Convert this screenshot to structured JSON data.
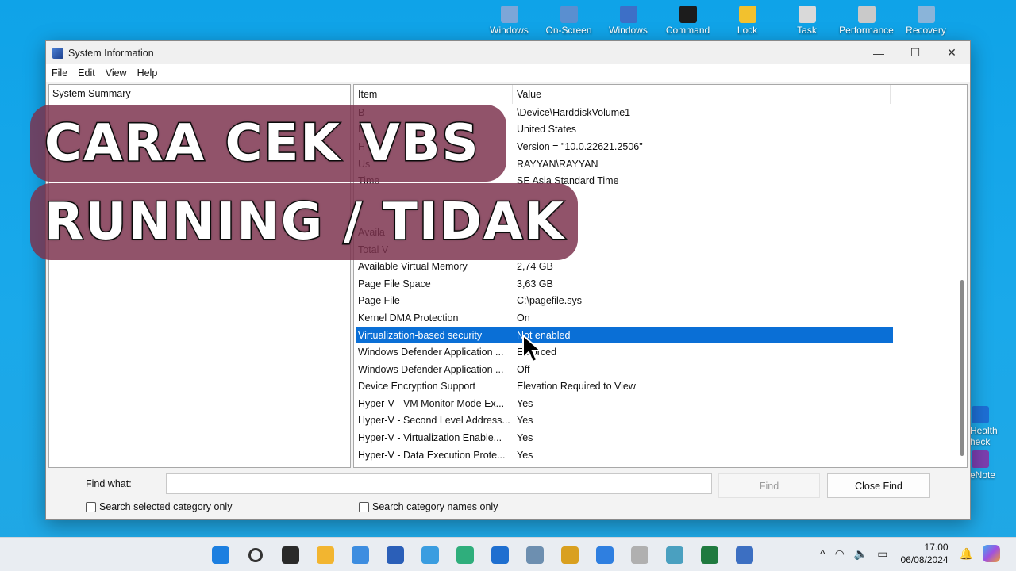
{
  "desktop": {
    "top_icons": [
      {
        "label": "Windows",
        "icon": "windows-tools-icon",
        "color": "#7da6d8"
      },
      {
        "label": "On-Screen",
        "icon": "keyboard-icon",
        "color": "#5a8fd0"
      },
      {
        "label": "Windows",
        "icon": "powershell-icon",
        "color": "#3d6fc7"
      },
      {
        "label": "Command",
        "icon": "terminal-icon",
        "color": "#1c1c1c"
      },
      {
        "label": "Lock",
        "icon": "lock-icon",
        "color": "#f2c12e"
      },
      {
        "label": "Task",
        "icon": "task-scheduler-icon",
        "color": "#d9d9d9"
      },
      {
        "label": "Performance",
        "icon": "performance-icon",
        "color": "#c9c9c9"
      },
      {
        "label": "Recovery",
        "icon": "recovery-icon",
        "color": "#8ab4d9"
      }
    ],
    "right_icons": [
      {
        "label": "Health\nheck",
        "icon": "health-check-icon",
        "color": "#1d6fd6"
      },
      {
        "label": "eNote",
        "icon": "onenote-icon",
        "color": "#7b3fb0"
      }
    ]
  },
  "window": {
    "title": "System Information",
    "controls": {
      "minimize": "—",
      "maximize": "☐",
      "close": "✕"
    },
    "menu": [
      "File",
      "Edit",
      "View",
      "Help"
    ],
    "tree": {
      "root": "System Summary"
    },
    "list": {
      "headers": {
        "item": "Item",
        "value": "Value"
      },
      "rows": [
        {
          "item": "B",
          "value": "\\Device\\HarddiskVolume1"
        },
        {
          "item": "L",
          "value": "United States"
        },
        {
          "item": "H",
          "value": "Version = \"10.0.22621.2506\""
        },
        {
          "item": "Us",
          "value": "RAYYAN\\RAYYAN"
        },
        {
          "item": "Time",
          "value": "SE Asia Standard Time"
        },
        {
          "item": "",
          "value": ""
        },
        {
          "item": "",
          "value": ""
        },
        {
          "item": "Availa",
          "value": ""
        },
        {
          "item": "Total V",
          "value": ""
        },
        {
          "item": "Available Virtual Memory",
          "value": "2,74 GB"
        },
        {
          "item": "Page File Space",
          "value": "3,63 GB"
        },
        {
          "item": "Page File",
          "value": "C:\\pagefile.sys"
        },
        {
          "item": "Kernel DMA Protection",
          "value": "On"
        },
        {
          "item": "Virtualization-based security",
          "value": "Not enabled",
          "selected": true
        },
        {
          "item": "Windows Defender Application ...",
          "value": "Enforced"
        },
        {
          "item": "Windows Defender Application ...",
          "value": "Off"
        },
        {
          "item": "Device Encryption Support",
          "value": "Elevation Required to View"
        },
        {
          "item": "Hyper-V - VM Monitor Mode Ex...",
          "value": "Yes"
        },
        {
          "item": "Hyper-V - Second Level Address...",
          "value": "Yes"
        },
        {
          "item": "Hyper-V - Virtualization Enable...",
          "value": "Yes"
        },
        {
          "item": "Hyper-V - Data Execution Prote...",
          "value": "Yes"
        }
      ]
    },
    "find": {
      "label": "Find what:",
      "value": "",
      "find_button": "Find",
      "close_find_button": "Close Find",
      "check_selected": "Search selected category only",
      "check_names": "Search category names only"
    },
    "selection_color": "#0a6fd6"
  },
  "overlay": {
    "line1": "CARA CEK VBS",
    "line2": "RUNNING / TIDAK",
    "banner_color": "#7c324e"
  },
  "taskbar": {
    "apps": [
      {
        "icon": "windows-start-icon",
        "color": "#1c7fe0"
      },
      {
        "icon": "search-icon",
        "color": "#333333"
      },
      {
        "icon": "obs-icon",
        "color": "#2a2a2a"
      },
      {
        "icon": "file-explorer-icon",
        "color": "#f2b530"
      },
      {
        "icon": "store-icon",
        "color": "#3d8de0"
      },
      {
        "icon": "word-icon",
        "color": "#2b5fb8"
      },
      {
        "icon": "photos-icon",
        "color": "#3a9de0"
      },
      {
        "icon": "edge-icon",
        "color": "#2fae7c"
      },
      {
        "icon": "pulse-icon",
        "color": "#1f6fd0"
      },
      {
        "icon": "image-viewer-icon",
        "color": "#6d8fb0"
      },
      {
        "icon": "clock-app-icon",
        "color": "#d9a020"
      },
      {
        "icon": "calendar-icon",
        "color": "#2f7fe0"
      },
      {
        "icon": "gauge-icon",
        "color": "#b0b0b0"
      },
      {
        "icon": "magnifier-icon",
        "color": "#4aa0c0"
      },
      {
        "icon": "excel-icon",
        "color": "#1f7a3f"
      },
      {
        "icon": "system-info-icon",
        "color": "#3c6fc2"
      }
    ],
    "tray": {
      "chevron": "^",
      "wifi": "◠",
      "volume": "🔈",
      "battery": "▭",
      "time": "17.00",
      "date": "06/08/2024"
    }
  }
}
